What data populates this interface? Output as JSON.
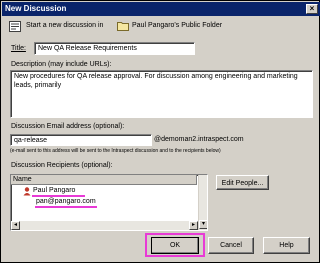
{
  "window": {
    "title": "New Discussion",
    "close_glyph": "×"
  },
  "header": {
    "text": "Start a new discussion in",
    "folder": "Paul Pangaro's Public Folder"
  },
  "form": {
    "title_label": "Title:",
    "title_value": "New QA Release Requirements",
    "description_label": "Description (may include URLs):",
    "description_value": "New procedures for QA release approval. For discussion among engineering and marketing leads, primarily",
    "email_label": "Discussion Email address (optional):",
    "email_value": "qa-release",
    "email_domain": "@demoman2.intraspect.com",
    "email_note": "(e-mail sent to this address will be sent to the Intraspect discussion and to the recipients below)",
    "recipients_label": "Discussion Recipients (optional):",
    "recipients_column": "Name",
    "recipients": [
      {
        "name": "Paul Pangaro",
        "email": "pan@pangaro.com"
      }
    ],
    "edit_people_label": "Edit People..."
  },
  "buttons": {
    "ok": "OK",
    "cancel": "Cancel",
    "help": "Help"
  },
  "colors": {
    "titlebar": "#0a246a",
    "highlight": "#e83ad6",
    "face": "#d4d0c8"
  }
}
